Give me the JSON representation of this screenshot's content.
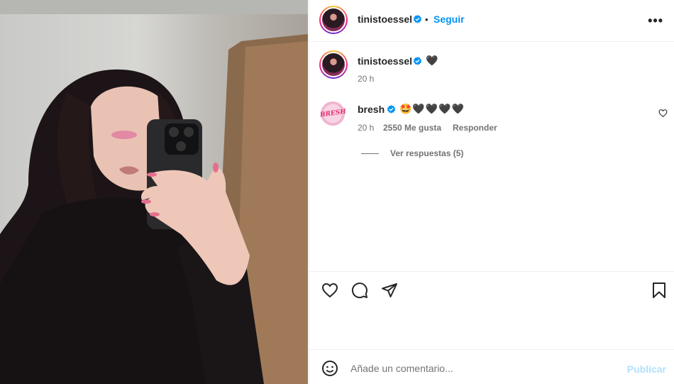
{
  "post": {
    "author": "tinistoessel",
    "follow_label": "Seguir",
    "separator": "•",
    "more_label": "•••",
    "caption": {
      "username": "tinistoessel",
      "emoji": "🖤",
      "time": "20 h"
    },
    "comments": [
      {
        "username": "bresh",
        "avatar_text": "BRESH",
        "text": "🤩🖤🖤🖤🖤",
        "time": "20 h",
        "likes": "2550 Me gusta",
        "reply_label": "Responder",
        "view_replies": "Ver respuestas (5)"
      }
    ],
    "comment_placeholder": "Añade un comentario...",
    "publish_label": "Publicar"
  },
  "colors": {
    "accent": "#0095f6",
    "verified": "#0095f6",
    "publish_disabled": "#b2dffc",
    "muted": "#737373"
  },
  "icons": {
    "like": "heart-outline-icon",
    "comment": "comment-bubble-icon",
    "share": "paper-plane-icon",
    "save": "bookmark-icon",
    "emoji": "smiley-icon"
  }
}
